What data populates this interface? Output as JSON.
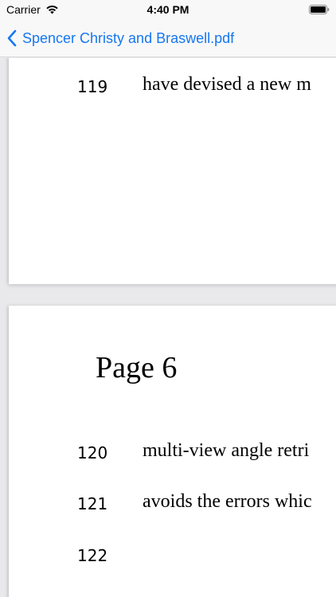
{
  "status_bar": {
    "carrier": "Carrier",
    "time": "4:40 PM",
    "icons": [
      "wifi-icon",
      "battery-icon"
    ]
  },
  "nav": {
    "back_label": "Spencer Christy and Braswell.pdf",
    "accent_color": "#1677f3"
  },
  "document": {
    "pages": [
      {
        "lines": [
          {
            "number": "119",
            "text": "have devised a new m"
          }
        ]
      },
      {
        "heading": "Page 6",
        "lines": [
          {
            "number": "120",
            "text": "multi-view angle retri"
          },
          {
            "number": "121",
            "text": "avoids the errors whic"
          },
          {
            "number": "122",
            "text": ""
          }
        ]
      }
    ]
  }
}
